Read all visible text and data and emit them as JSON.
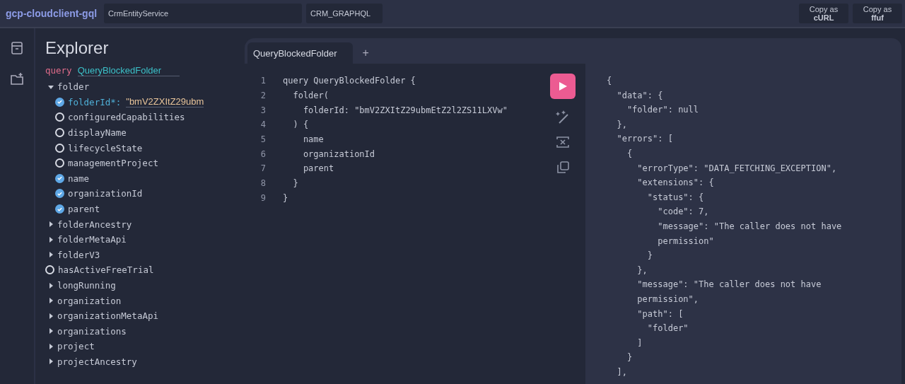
{
  "header": {
    "app_name": "gcp-cloudclient-gql",
    "service_field": "CrmEntityService",
    "endpoint_field": "CRM_GRAPHQL",
    "buttons": [
      {
        "top": "Copy as",
        "bottom": "cURL"
      },
      {
        "top": "Copy as",
        "bottom": "ffuf"
      }
    ]
  },
  "explorer": {
    "title": "Explorer",
    "operation_keyword": "query",
    "operation_name": "QueryBlockedFolder",
    "fields": [
      {
        "kind": "object",
        "name": "folder",
        "expanded": true,
        "children": [
          {
            "kind": "argument",
            "name": "folderId*:",
            "value": "\"bmV2ZXItZ29ubm",
            "checked": true
          },
          {
            "kind": "scalar",
            "name": "configuredCapabilities",
            "checked": false
          },
          {
            "kind": "scalar",
            "name": "displayName",
            "checked": false
          },
          {
            "kind": "scalar",
            "name": "lifecycleState",
            "checked": false
          },
          {
            "kind": "scalar",
            "name": "managementProject",
            "checked": false
          },
          {
            "kind": "scalar",
            "name": "name",
            "checked": true
          },
          {
            "kind": "scalar",
            "name": "organizationId",
            "checked": true
          },
          {
            "kind": "scalar",
            "name": "parent",
            "checked": true
          }
        ]
      },
      {
        "kind": "object",
        "name": "folderAncestry",
        "expanded": false
      },
      {
        "kind": "object",
        "name": "folderMetaApi",
        "expanded": false
      },
      {
        "kind": "object",
        "name": "folderV3",
        "expanded": false
      },
      {
        "kind": "scalar",
        "name": "hasActiveFreeTrial",
        "checked": false
      },
      {
        "kind": "object",
        "name": "longRunning",
        "expanded": false
      },
      {
        "kind": "object",
        "name": "organization",
        "expanded": false
      },
      {
        "kind": "object",
        "name": "organizationMetaApi",
        "expanded": false
      },
      {
        "kind": "object",
        "name": "organizations",
        "expanded": false
      },
      {
        "kind": "object",
        "name": "project",
        "expanded": false
      },
      {
        "kind": "object",
        "name": "projectAncestry",
        "expanded": false
      }
    ]
  },
  "tabs": [
    {
      "label": "QueryBlockedFolder",
      "selected": true
    }
  ],
  "new_tab": "+",
  "query_lines": [
    {
      "number": "1",
      "text": "query QueryBlockedFolder {"
    },
    {
      "number": "2",
      "text": "  folder("
    },
    {
      "number": "3",
      "text": "    folderId: \"bmV2ZXItZ29ubmEtZ2l2ZS11LXVw\""
    },
    {
      "number": "4",
      "text": "  ) {"
    },
    {
      "number": "5",
      "text": "    name"
    },
    {
      "number": "6",
      "text": "    organizationId"
    },
    {
      "number": "7",
      "text": "    parent"
    },
    {
      "number": "8",
      "text": "  }"
    },
    {
      "number": "9",
      "text": "}"
    }
  ],
  "response_lines": [
    "{",
    "  \"data\": {",
    "    \"folder\": null",
    "  },",
    "  \"errors\": [",
    "    {",
    "      \"errorType\": \"DATA_FETCHING_EXCEPTION\",",
    "      \"extensions\": {",
    "        \"status\": {",
    "          \"code\": 7,",
    "          \"message\": \"The caller does not have",
    "          permission\"",
    "        }",
    "      },",
    "      \"message\": \"The caller does not have",
    "      permission\",",
    "      \"path\": [",
    "        \"folder\"",
    "      ]",
    "    }",
    "  ],"
  ]
}
